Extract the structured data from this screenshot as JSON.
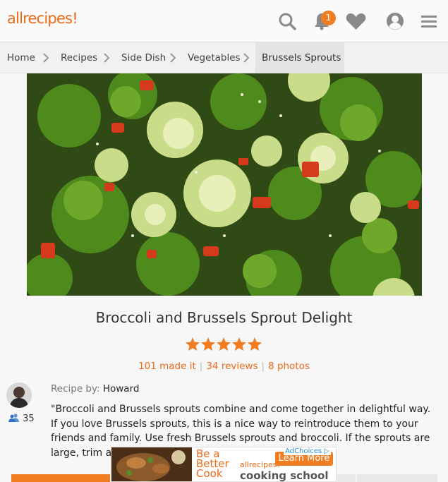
{
  "header": {
    "logo": "allrecipes",
    "notification_count": "1"
  },
  "breadcrumbs": [
    "Home",
    "Recipes",
    "Side Dish",
    "Vegetables",
    "Brussels Sprouts"
  ],
  "recipe": {
    "title": "Broccoli and Brussels Sprout Delight",
    "rating": 5,
    "made_it": "101 made it",
    "reviews": "34 reviews",
    "photos": "8 photos",
    "recipe_by_label": "Recipe by:",
    "author": "Howard",
    "followers": "35",
    "description": "\"Broccoli and Brussels sprouts combine and come together in delightful way. If you love Brussels sprouts, this is a nice way to reintroduce them to your friends and family. Use fresh Brussels sprouts and broccoli. If the sprouts are large, trim and quarter t"
  },
  "ad": {
    "headline": "Be a Better Cook",
    "brand": "allrecipes",
    "product": "cooking school",
    "cta": "Learn More",
    "adchoices": "AdChoices"
  },
  "colors": {
    "accent": "#e96a1a",
    "star": "#f07d22",
    "header_bg": "#fafafa"
  }
}
